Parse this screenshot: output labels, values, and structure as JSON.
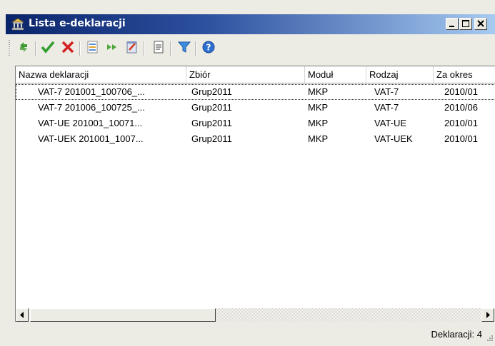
{
  "window": {
    "title": "Lista e-deklaracji",
    "icon": "bank-building-icon",
    "controls": [
      "minimize-icon",
      "maximize-icon",
      "close-icon"
    ]
  },
  "toolbar": {
    "items": [
      "refresh-arrows-icon",
      "approve-check-icon",
      "reject-x-icon",
      "export-list-icon",
      "send-arrows-icon",
      "edit-document-icon",
      "view-document-icon",
      "filter-icon",
      "help-icon"
    ]
  },
  "list": {
    "columns": [
      "Nazwa deklaracji",
      "Zbiór",
      "Moduł",
      "Rodzaj",
      "Za okres"
    ],
    "rows": [
      [
        "VAT-7 201001_100706_...",
        "Grup2011",
        "MKP",
        "VAT-7",
        "2010/01"
      ],
      [
        "VAT-7 201006_100725_...",
        "Grup2011",
        "MKP",
        "VAT-7",
        "2010/06"
      ],
      [
        "VAT-UE 201001_10071...",
        "Grup2011",
        "MKP",
        "VAT-UE",
        "2010/01"
      ],
      [
        "VAT-UEK 201001_1007...",
        "Grup2011",
        "MKP",
        "VAT-UEK",
        "2010/01"
      ]
    ],
    "focused_row": 1
  },
  "status": {
    "text": "Deklaracji: 4"
  },
  "colors": {
    "titlebar_start": "#0a246a",
    "titlebar_end": "#a6caf0",
    "window_bg": "#ecebe4"
  }
}
